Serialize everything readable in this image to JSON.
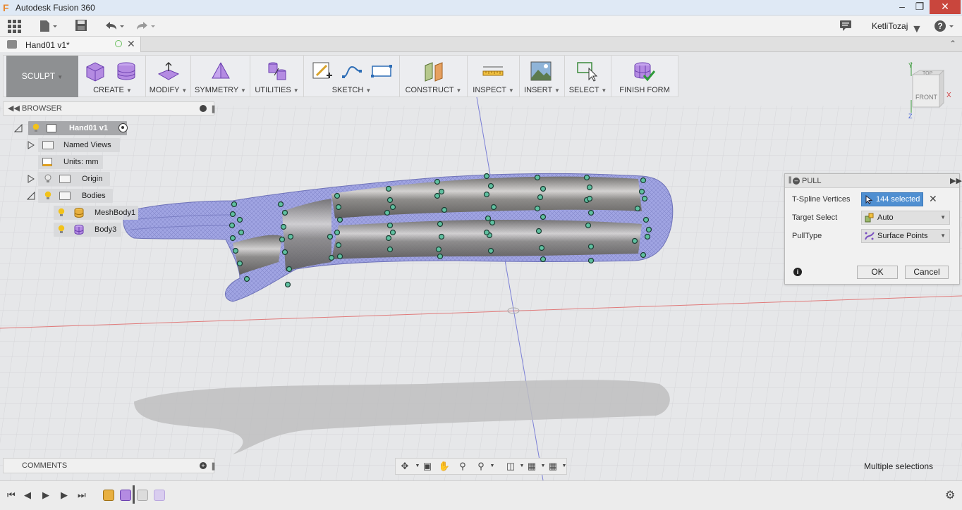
{
  "window": {
    "title": "Autodesk Fusion 360",
    "logo_letter": "F"
  },
  "app_toolbar": {
    "user": "KetliTozaj"
  },
  "document_tab": {
    "name": "Hand01 v1*"
  },
  "ribbon": {
    "workspace": "SCULPT",
    "groups": [
      {
        "label": "CREATE"
      },
      {
        "label": "MODIFY"
      },
      {
        "label": "SYMMETRY"
      },
      {
        "label": "UTILITIES"
      },
      {
        "label": "SKETCH"
      },
      {
        "label": "CONSTRUCT"
      },
      {
        "label": "INSPECT"
      },
      {
        "label": "INSERT"
      },
      {
        "label": "SELECT"
      },
      {
        "label": "FINISH FORM"
      }
    ]
  },
  "browser": {
    "title": "BROWSER",
    "root": "Hand01 v1",
    "items": [
      {
        "label": "Named Views"
      },
      {
        "label": "Units: mm"
      },
      {
        "label": "Origin"
      },
      {
        "label": "Bodies"
      },
      {
        "label": "MeshBody1"
      },
      {
        "label": "Body3"
      }
    ]
  },
  "pull_dialog": {
    "title": "PULL",
    "rows": [
      {
        "label": "T-Spline Vertices",
        "value": "144 selected"
      },
      {
        "label": "Target Select",
        "value": "Auto"
      },
      {
        "label": "PullType",
        "value": "Surface Points"
      }
    ],
    "ok": "OK",
    "cancel": "Cancel"
  },
  "comments": {
    "title": "COMMENTS"
  },
  "status": {
    "text": "Multiple selections"
  },
  "viewcube": {
    "front": "FRONT",
    "top": "TOP",
    "axis_x": "X",
    "axis_y": "Y",
    "axis_z": "Z"
  },
  "colors": {
    "mesh": "#9a9ee0",
    "tspline": "#9c9a90",
    "vertex": "#5fc0a0",
    "selected": "#4f8fd1",
    "workspace": "#8e9092"
  }
}
